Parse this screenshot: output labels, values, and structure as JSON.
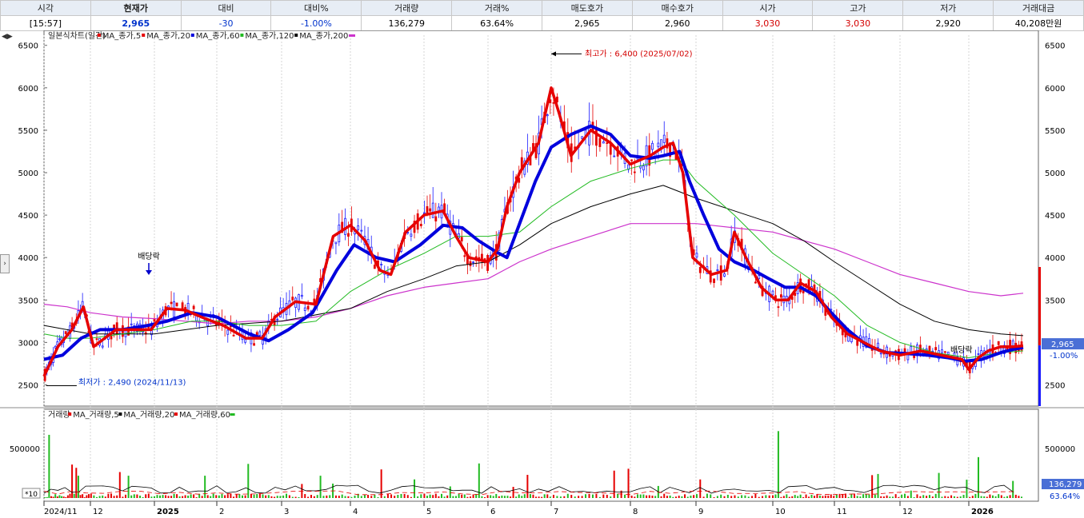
{
  "quote": {
    "headers": [
      "시각",
      "현재가",
      "대비",
      "대비%",
      "거래량",
      "거래%",
      "매도호가",
      "매수호가",
      "시가",
      "고가",
      "저가",
      "거래대금"
    ],
    "values": [
      "[15:57]",
      "2,965",
      "-30",
      "-1.00%",
      "136,279",
      "63.64%",
      "2,965",
      "2,960",
      "3,030",
      "3,030",
      "2,920",
      "40,208만원"
    ]
  },
  "colors": {
    "up": "#e60000",
    "down": "#1a1aff",
    "ma5": "#e60000",
    "ma20": "#0000dd",
    "ma60": "#22bb22",
    "ma120": "#000000",
    "ma200": "#cc33cc",
    "vol_ma5": "#e60000",
    "vol_ma20": "#000000",
    "vol_ma60": "#22bb22",
    "price_tag": "#4a6fd6"
  },
  "price_legend": [
    "일본식차트(일간)",
    "MA_종가,5",
    "MA_종가,20",
    "MA_종가,60",
    "MA_종가,120",
    "MA_종가,200"
  ],
  "volume_legend": [
    "거래량",
    "MA_거래량,5",
    "MA_거래량,20",
    "MA_거래량,60"
  ],
  "annotations": {
    "high": "최고가 : 6,400 (2025/07/02)",
    "low": "최저가 : 2,490 (2024/11/13)",
    "dividend_1": "배당락",
    "dividend_2": "배당락"
  },
  "current_tag": {
    "price": "2,965",
    "change": "-1.00%",
    "volume": "136,279",
    "volume_pct": "63.64%"
  },
  "volume_unit": "*10",
  "chart_data": {
    "type": "candlestick",
    "price_ticks": [
      "2500",
      "3000",
      "3500",
      "4000",
      "4500",
      "5000",
      "5500",
      "6000",
      "6500"
    ],
    "volume_ticks": [
      "500000"
    ],
    "x_labels": [
      "2024/11",
      "12",
      "2025",
      "2",
      "3",
      "4",
      "5",
      "6",
      "7",
      "8",
      "9",
      "10",
      "11",
      "12",
      "2026"
    ],
    "ylim": [
      2250,
      6620
    ],
    "ma5": [
      [
        0,
        2600
      ],
      [
        0.3,
        2950
      ],
      [
        0.6,
        3150
      ],
      [
        0.85,
        3420
      ],
      [
        1.05,
        2950
      ],
      [
        1.4,
        3150
      ],
      [
        1.7,
        3150
      ],
      [
        1.95,
        3150
      ],
      [
        2.2,
        3400
      ],
      [
        2.5,
        3380
      ],
      [
        2.75,
        3300
      ],
      [
        3.1,
        3200
      ],
      [
        3.45,
        3050
      ],
      [
        3.7,
        3050
      ],
      [
        3.9,
        3300
      ],
      [
        4.2,
        3480
      ],
      [
        4.5,
        3450
      ],
      [
        4.75,
        4250
      ],
      [
        5.0,
        4380
      ],
      [
        5.2,
        4200
      ],
      [
        5.4,
        3850
      ],
      [
        5.55,
        3800
      ],
      [
        5.75,
        4300
      ],
      [
        6.0,
        4500
      ],
      [
        6.3,
        4550
      ],
      [
        6.5,
        4250
      ],
      [
        6.7,
        4000
      ],
      [
        7.0,
        3950
      ],
      [
        7.15,
        4100
      ],
      [
        7.3,
        4600
      ],
      [
        7.5,
        5000
      ],
      [
        7.8,
        5350
      ],
      [
        8.0,
        6000
      ],
      [
        8.1,
        5700
      ],
      [
        8.25,
        5200
      ],
      [
        8.5,
        5500
      ],
      [
        8.75,
        5350
      ],
      [
        9.0,
        5100
      ],
      [
        9.3,
        5200
      ],
      [
        9.5,
        5300
      ],
      [
        9.65,
        5350
      ],
      [
        9.8,
        5000
      ],
      [
        9.95,
        4000
      ],
      [
        10.2,
        3800
      ],
      [
        10.4,
        3850
      ],
      [
        10.5,
        4300
      ],
      [
        10.65,
        4000
      ],
      [
        10.85,
        3650
      ],
      [
        11.05,
        3500
      ],
      [
        11.25,
        3500
      ],
      [
        11.45,
        3700
      ],
      [
        11.7,
        3600
      ],
      [
        11.95,
        3300
      ],
      [
        12.2,
        3100
      ],
      [
        12.45,
        3000
      ],
      [
        12.7,
        2900
      ],
      [
        13.0,
        2850
      ],
      [
        13.3,
        2900
      ],
      [
        13.6,
        2850
      ],
      [
        13.9,
        2800
      ],
      [
        14.0,
        2680
      ],
      [
        14.15,
        2820
      ],
      [
        14.3,
        2900
      ],
      [
        14.5,
        2950
      ],
      [
        14.7,
        2950
      ],
      [
        14.85,
        2960
      ]
    ],
    "ma20": [
      [
        0,
        2800
      ],
      [
        0.4,
        2850
      ],
      [
        0.8,
        3050
      ],
      [
        1.15,
        3150
      ],
      [
        1.5,
        3150
      ],
      [
        1.9,
        3200
      ],
      [
        2.2,
        3250
      ],
      [
        2.6,
        3350
      ],
      [
        3.0,
        3300
      ],
      [
        3.5,
        3100
      ],
      [
        3.8,
        3020
      ],
      [
        4.1,
        3150
      ],
      [
        4.45,
        3350
      ],
      [
        4.8,
        3850
      ],
      [
        5.05,
        4150
      ],
      [
        5.35,
        4000
      ],
      [
        5.6,
        3950
      ],
      [
        5.95,
        4150
      ],
      [
        6.3,
        4380
      ],
      [
        6.6,
        4350
      ],
      [
        6.85,
        4200
      ],
      [
        7.1,
        4080
      ],
      [
        7.3,
        4000
      ],
      [
        7.5,
        4400
      ],
      [
        7.75,
        4900
      ],
      [
        8.0,
        5300
      ],
      [
        8.25,
        5450
      ],
      [
        8.5,
        5550
      ],
      [
        8.75,
        5450
      ],
      [
        9.0,
        5200
      ],
      [
        9.3,
        5170
      ],
      [
        9.5,
        5200
      ],
      [
        9.75,
        5250
      ],
      [
        9.9,
        4900
      ],
      [
        10.1,
        4500
      ],
      [
        10.3,
        4100
      ],
      [
        10.5,
        3950
      ],
      [
        10.75,
        3850
      ],
      [
        10.95,
        3750
      ],
      [
        11.2,
        3650
      ],
      [
        11.45,
        3650
      ],
      [
        11.7,
        3550
      ],
      [
        11.95,
        3350
      ],
      [
        12.2,
        3150
      ],
      [
        12.5,
        2960
      ],
      [
        12.8,
        2880
      ],
      [
        13.1,
        2870
      ],
      [
        13.4,
        2850
      ],
      [
        13.7,
        2820
      ],
      [
        13.95,
        2780
      ],
      [
        14.2,
        2800
      ],
      [
        14.5,
        2880
      ],
      [
        14.7,
        2920
      ],
      [
        14.85,
        2940
      ]
    ],
    "ma60": [
      [
        0,
        3100
      ],
      [
        0.5,
        3050
      ],
      [
        1.0,
        3050
      ],
      [
        1.5,
        3100
      ],
      [
        2.0,
        3150
      ],
      [
        2.6,
        3250
      ],
      [
        3.0,
        3250
      ],
      [
        3.5,
        3200
      ],
      [
        4.0,
        3200
      ],
      [
        4.5,
        3250
      ],
      [
        5.0,
        3600
      ],
      [
        5.5,
        3850
      ],
      [
        6.0,
        4050
      ],
      [
        6.5,
        4250
      ],
      [
        7.0,
        4250
      ],
      [
        7.5,
        4300
      ],
      [
        8.0,
        4600
      ],
      [
        8.5,
        4900
      ],
      [
        9.0,
        5050
      ],
      [
        9.5,
        5150
      ],
      [
        9.75,
        5150
      ],
      [
        10.0,
        4900
      ],
      [
        10.5,
        4500
      ],
      [
        11.0,
        4050
      ],
      [
        11.5,
        3800
      ],
      [
        12.0,
        3550
      ],
      [
        12.5,
        3200
      ],
      [
        13.0,
        3000
      ],
      [
        13.5,
        2880
      ],
      [
        14.0,
        2820
      ],
      [
        14.5,
        2880
      ],
      [
        14.85,
        2900
      ]
    ],
    "ma120": [
      [
        0,
        3200
      ],
      [
        1.0,
        3100
      ],
      [
        2.0,
        3100
      ],
      [
        3.0,
        3200
      ],
      [
        4.0,
        3250
      ],
      [
        5.0,
        3400
      ],
      [
        5.5,
        3600
      ],
      [
        6.0,
        3750
      ],
      [
        6.5,
        3900
      ],
      [
        7.0,
        3950
      ],
      [
        7.5,
        4150
      ],
      [
        8.0,
        4400
      ],
      [
        8.5,
        4600
      ],
      [
        9.0,
        4750
      ],
      [
        9.5,
        4850
      ],
      [
        10.0,
        4700
      ],
      [
        10.5,
        4550
      ],
      [
        11.0,
        4400
      ],
      [
        11.5,
        4200
      ],
      [
        12.0,
        3950
      ],
      [
        12.5,
        3700
      ],
      [
        13.0,
        3450
      ],
      [
        13.5,
        3250
      ],
      [
        14.0,
        3150
      ],
      [
        14.5,
        3100
      ],
      [
        14.85,
        3080
      ]
    ],
    "ma200": [
      [
        0,
        3450
      ],
      [
        0.5,
        3420
      ],
      [
        1.0,
        3350
      ],
      [
        1.5,
        3300
      ],
      [
        2.0,
        3280
      ],
      [
        2.5,
        3250
      ],
      [
        3.0,
        3220
      ],
      [
        3.5,
        3250
      ],
      [
        4.0,
        3250
      ],
      [
        4.5,
        3300
      ],
      [
        5.0,
        3400
      ],
      [
        5.5,
        3550
      ],
      [
        6.0,
        3650
      ],
      [
        6.5,
        3700
      ],
      [
        7.0,
        3750
      ],
      [
        7.5,
        3950
      ],
      [
        8.0,
        4100
      ],
      [
        8.5,
        4250
      ],
      [
        9.0,
        4400
      ],
      [
        9.5,
        4400
      ],
      [
        10.0,
        4400
      ],
      [
        10.5,
        4350
      ],
      [
        11.0,
        4300
      ],
      [
        11.5,
        4200
      ],
      [
        12.0,
        4100
      ],
      [
        12.5,
        3950
      ],
      [
        13.0,
        3800
      ],
      [
        13.5,
        3700
      ],
      [
        14.0,
        3600
      ],
      [
        14.5,
        3550
      ],
      [
        14.85,
        3580
      ]
    ],
    "highlights": [
      [
        0.05,
        2490,
        "low"
      ],
      [
        8.0,
        6400,
        "high"
      ]
    ]
  }
}
